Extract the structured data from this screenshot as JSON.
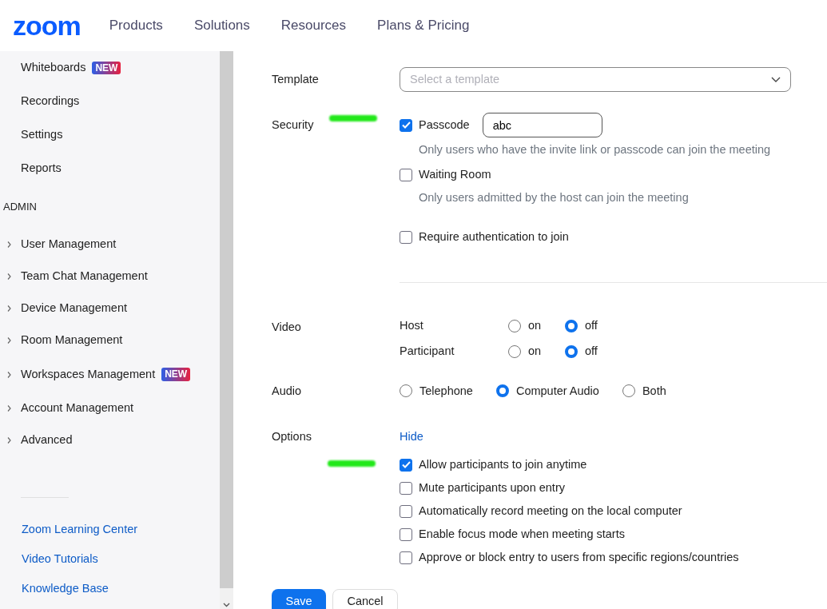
{
  "header": {
    "logo": "zoom",
    "nav": [
      "Products",
      "Solutions",
      "Resources",
      "Plans & Pricing"
    ]
  },
  "sidebar": {
    "items": [
      {
        "label": "Whiteboards",
        "badge": "NEW"
      },
      {
        "label": "Recordings"
      },
      {
        "label": "Settings"
      },
      {
        "label": "Reports"
      }
    ],
    "section": "ADMIN",
    "admin_items": [
      {
        "label": "User Management",
        "expanded": false
      },
      {
        "label": "Team Chat Management",
        "expanded": false
      },
      {
        "label": "Device Management",
        "expanded": false
      },
      {
        "label": "Room Management",
        "expanded": false
      },
      {
        "label": "Workspaces Management",
        "expanded": false,
        "badge": "NEW"
      },
      {
        "label": "Account Management",
        "expanded": false
      },
      {
        "label": "Advanced",
        "expanded": false
      }
    ],
    "links": [
      "Zoom Learning Center",
      "Video Tutorials",
      "Knowledge Base"
    ]
  },
  "form": {
    "template": {
      "label": "Template",
      "placeholder": "Select a template"
    },
    "security": {
      "label": "Security",
      "options": [
        {
          "label": "Passcode",
          "checked": true,
          "value": "abc",
          "note": "Only users who have the invite link or passcode can join the meeting"
        },
        {
          "label": "Waiting Room",
          "checked": false,
          "note": "Only users admitted by the host can join the meeting"
        },
        {
          "label": "Require authentication to join",
          "checked": false
        }
      ]
    },
    "video": {
      "label": "Video",
      "rows": [
        {
          "label": "Host",
          "choices": [
            {
              "label": "on",
              "selected": false
            },
            {
              "label": "off",
              "selected": true
            }
          ]
        },
        {
          "label": "Participant",
          "choices": [
            {
              "label": "on",
              "selected": false
            },
            {
              "label": "off",
              "selected": true
            }
          ]
        }
      ]
    },
    "audio": {
      "label": "Audio",
      "choices": [
        {
          "label": "Telephone",
          "selected": false
        },
        {
          "label": "Computer Audio",
          "selected": true
        },
        {
          "label": "Both",
          "selected": false
        }
      ]
    },
    "options": {
      "label": "Options",
      "toggle": "Hide",
      "items": [
        {
          "label": "Allow participants to join anytime",
          "checked": true
        },
        {
          "label": "Mute participants upon entry",
          "checked": false
        },
        {
          "label": "Automatically record meeting on the local computer",
          "checked": false
        },
        {
          "label": "Enable focus mode when meeting starts",
          "checked": false
        },
        {
          "label": "Approve or block entry to users from specific regions/countries",
          "checked": false
        }
      ]
    },
    "buttons": [
      {
        "label": "Save",
        "kind": "primary"
      },
      {
        "label": "Cancel",
        "kind": "secondary"
      }
    ]
  }
}
